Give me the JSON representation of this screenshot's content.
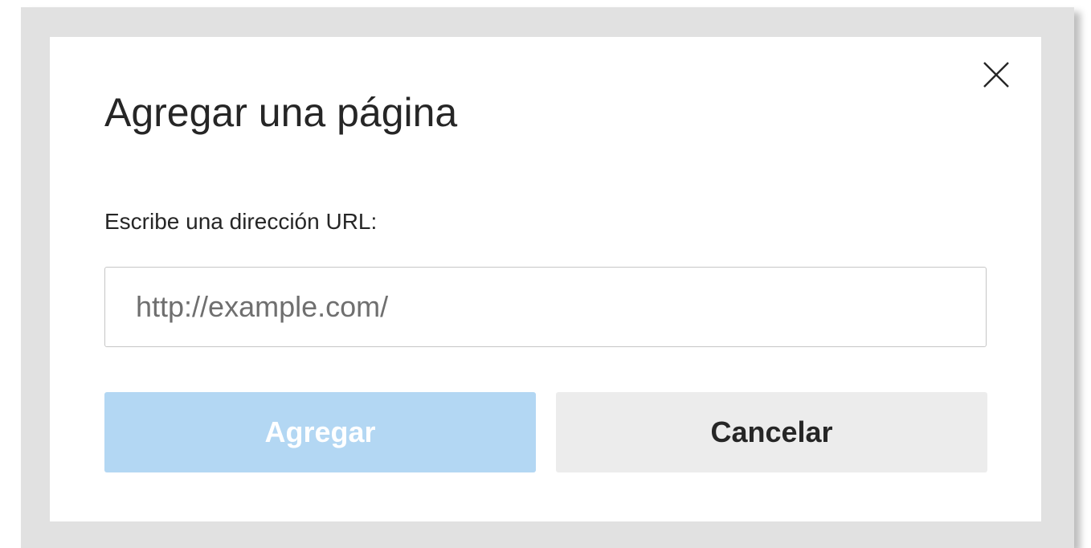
{
  "dialog": {
    "title": "Agregar una página",
    "url_label": "Escribe una dirección URL:",
    "url_input": {
      "value": "",
      "placeholder": "http://example.com/"
    },
    "add_button_label": "Agregar",
    "cancel_button_label": "Cancelar",
    "close_icon": "close-icon"
  },
  "colors": {
    "add_button_bg_disabled": "#b3d7f3",
    "cancel_button_bg": "#ececec",
    "frame_bg": "#e1e1e1"
  }
}
